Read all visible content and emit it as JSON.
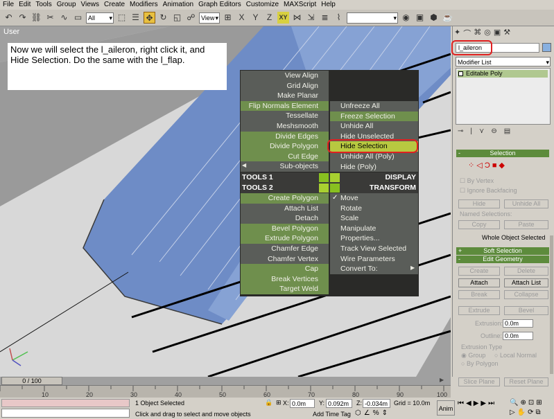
{
  "menubar": [
    "File",
    "Edit",
    "Tools",
    "Group",
    "Views",
    "Create",
    "Modifiers",
    "Animation",
    "Graph Editors",
    "Customize",
    "MAXScript",
    "Help"
  ],
  "toolbar": {
    "selection_filter": "All",
    "ref_coord": "View",
    "xy_label": "XY"
  },
  "viewport": {
    "label": "User",
    "instruction": "Now we will select the l_aileron, right click it, and Hide Selection.  Do the same with the l_flap."
  },
  "quad": {
    "top_left": [
      "View Align",
      "Grid Align",
      "Make Planar",
      "Flip Normals Element",
      "Tessellate",
      "Meshsmooth",
      "Divide Edges",
      "Divide Polygon",
      "Cut Edge",
      "Sub-objects"
    ],
    "top_right": [
      "Unfreeze All",
      "Freeze Selection",
      "Unhide All",
      "Hide Unselected",
      "Hide Selection",
      "Unhide All (Poly)",
      "Hide (Poly)"
    ],
    "tools1": "TOOLS 1",
    "display": "DISPLAY",
    "tools2": "TOOLS 2",
    "transform": "TRANSFORM",
    "bottom_left": [
      "Create Polygon",
      "Attach List",
      "Detach",
      "Bevel Polygon",
      "Extrude Polygon",
      "Chamfer Edge",
      "Chamfer Vertex",
      "Cap",
      "Break Vertices",
      "Target Weld"
    ],
    "bottom_right": [
      "Move",
      "Rotate",
      "Scale",
      "Manipulate",
      "Properties...",
      "Track View Selected",
      "Wire Parameters",
      "Convert To:"
    ]
  },
  "panel": {
    "object_name": "l_aileron",
    "modifier_list": "Modifier List",
    "stack_item": "Editable Poly",
    "selection_title": "Selection",
    "by_vertex": "By Vertex",
    "ignore_backfacing": "Ignore Backfacing",
    "hide": "Hide",
    "unhide_all": "Unhide All",
    "named_selections": "Named Selections:",
    "copy": "Copy",
    "paste": "Paste",
    "whole_object": "Whole Object Selected",
    "soft_selection": "Soft Selection",
    "edit_geometry": "Edit Geometry",
    "create": "Create",
    "delete": "Delete",
    "attach": "Attach",
    "attach_list": "Attach List",
    "break": "Break",
    "collapse": "Collapse",
    "extrude": "Extrude",
    "bevel": "Bevel",
    "extrusion_label": "Extrusion:",
    "extrusion_value": "0.0m",
    "outline_label": "Outline:",
    "outline_value": "0.0m",
    "extrusion_type": "Extrusion Type",
    "group": "Group",
    "local_normal": "Local Normal",
    "by_polygon": "By Polygon",
    "slice_plane": "Slice Plane",
    "reset_plane": "Reset Plane"
  },
  "timeline": {
    "frame": "0 / 100",
    "ticks": [
      "10",
      "20",
      "30",
      "40",
      "50",
      "60",
      "70",
      "80",
      "90",
      "100"
    ]
  },
  "status": {
    "selected": "1 Object Selected",
    "prompt": "Click and drag to select and move objects",
    "x": "0.0m",
    "y": "0.092m",
    "z": "-0.034m",
    "grid": "Grid = 10.0m",
    "add_time_tag": "Add Time Tag",
    "anim": "Anim"
  }
}
